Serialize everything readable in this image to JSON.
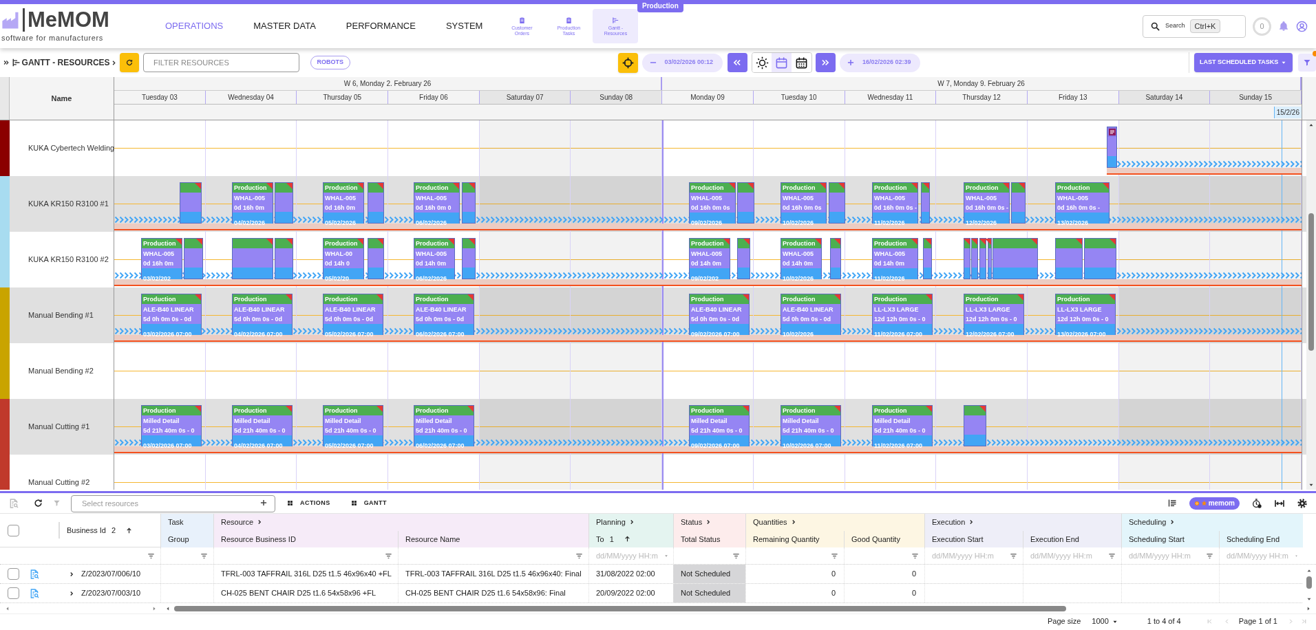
{
  "banner": "Production",
  "header": {
    "brand": "MeMOM",
    "tagline": "software for manufacturers",
    "nav": [
      {
        "label": "OPERATIONS",
        "selected": true
      },
      {
        "label": "MASTER DATA",
        "selected": false
      },
      {
        "label": "PERFORMANCE",
        "selected": false
      },
      {
        "label": "SYSTEM",
        "selected": false
      }
    ],
    "quick_links": [
      {
        "label": "Customer Orders",
        "selected": false
      },
      {
        "label": "Production Tasks",
        "selected": false
      },
      {
        "label": "Gantt - Resources",
        "selected": true
      }
    ],
    "search": {
      "label": "Search",
      "shortcut": "Ctrl+K"
    },
    "notification_count": "0"
  },
  "toolbar": {
    "title": "GANTT - RESOURCES",
    "filter": {
      "placeholder": "FILTER RESOURCES"
    },
    "chip": "ROBOTS",
    "range_start": "03/02/2026 00:12",
    "range_end": "16/02/2026 02:39",
    "view_modes": [
      {
        "kind": "sun",
        "selected": false
      },
      {
        "kind": "calendar",
        "selected": true
      },
      {
        "kind": "calendar-grid",
        "selected": false
      }
    ],
    "scheduled_menu": "LAST SCHEDULED TASKS",
    "filter_active": true
  },
  "gantt": {
    "name_heading": "Name",
    "today_label": "15/2/26",
    "weeks": [
      {
        "label": "W 6, Monday 2. February 26",
        "days": [
          {
            "label": "Tuesday 03",
            "weekend": false
          },
          {
            "label": "Wednesday 04",
            "weekend": false
          },
          {
            "label": "Thursday 05",
            "weekend": false
          },
          {
            "label": "Friday 06",
            "weekend": false
          },
          {
            "label": "Saturday 07",
            "weekend": true
          },
          {
            "label": "Sunday 08",
            "weekend": true
          }
        ]
      },
      {
        "label": "W 7, Monday 9. February 26",
        "days": [
          {
            "label": "Monday 09",
            "weekend": false
          },
          {
            "label": "Tuesday 10",
            "weekend": false
          },
          {
            "label": "Wednesday 11",
            "weekend": false
          },
          {
            "label": "Thursday 12",
            "weekend": false
          },
          {
            "label": "Friday 13",
            "weekend": false
          },
          {
            "label": "Saturday 14",
            "weekend": true
          },
          {
            "label": "Sunday 15",
            "weekend": true
          }
        ]
      }
    ],
    "rows": [
      {
        "name": "KUKA Cybertech Welding",
        "color": "#8b0000",
        "tasks": [
          {
            "kind": "note"
          }
        ]
      },
      {
        "name": "KUKA KR150 R3100 #1",
        "color": "#a8dcf0",
        "tasks": [
          {
            "kind": "block"
          },
          {
            "kind": "card",
            "type": "Production",
            "product": "WHAL-005",
            "duration": "0d 16h 0m",
            "date": "04/02/2026"
          },
          {
            "kind": "block"
          },
          {
            "kind": "card",
            "type": "Production",
            "product": "WHAL-005",
            "duration": "0d 16h 0m",
            "date": "05/02/2026"
          },
          {
            "kind": "block"
          },
          {
            "kind": "card",
            "type": "Production",
            "product": "WHAL-005",
            "duration": "0d 16h 0m 0",
            "date": "06/02/2026"
          },
          {
            "kind": "block"
          },
          {
            "kind": "card",
            "type": "Production",
            "product": "WHAL-005",
            "duration": "0d 16h 0m 0s",
            "date": "09/02/2026"
          },
          {
            "kind": "block"
          },
          {
            "kind": "card",
            "type": "Production",
            "product": "WHAL-005",
            "duration": "0d 16h 0m 0s",
            "date": "10/02/2026"
          },
          {
            "kind": "block"
          },
          {
            "kind": "card",
            "type": "Production",
            "product": "WHAL-005",
            "duration": "0d 16h 0m 0s -",
            "date": "11/02/2026"
          },
          {
            "kind": "block"
          },
          {
            "kind": "card",
            "type": "Production",
            "product": "WHAL-005",
            "duration": "0d 16h 0m 0s -",
            "date": "12/02/2026"
          },
          {
            "kind": "block"
          },
          {
            "kind": "card",
            "type": "Production",
            "product": "WHAL-005",
            "duration": "0d 16h 0m 0s -",
            "date": "13/02/2026"
          }
        ]
      },
      {
        "name": "KUKA KR150 R3100 #2",
        "color": "#a8dcf0",
        "tasks": [
          {
            "kind": "card",
            "type": "Production",
            "product": "WHAL-005",
            "duration": "0d 16h 0m",
            "date": "03/02/202"
          },
          {
            "kind": "block"
          },
          {
            "kind": "block"
          },
          {
            "kind": "block"
          },
          {
            "kind": "card",
            "type": "Production",
            "product": "WHAL-00",
            "duration": "0d 14h 0",
            "date": "05/02/20"
          },
          {
            "kind": "block"
          },
          {
            "kind": "card",
            "type": "Production",
            "product": "WHAL-005",
            "duration": "0d 14h 0m",
            "date": "06/02/2026"
          },
          {
            "kind": "block"
          },
          {
            "kind": "card",
            "type": "Production",
            "product": "WHAL-005",
            "duration": "0d 14h 0m",
            "date": "09/02/202"
          },
          {
            "kind": "block"
          },
          {
            "kind": "card",
            "type": "Production",
            "product": "WHAL-005",
            "duration": "0d 14h 0m",
            "date": "10/02/2026"
          },
          {
            "kind": "block"
          },
          {
            "kind": "card",
            "type": "Production",
            "product": "WHAL-005",
            "duration": "0d 14h 0m",
            "date": "11/02/2026"
          },
          {
            "kind": "block"
          },
          {
            "kind": "block"
          },
          {
            "kind": "block"
          },
          {
            "kind": "block"
          },
          {
            "kind": "block"
          },
          {
            "kind": "block"
          },
          {
            "kind": "block"
          },
          {
            "kind": "block"
          }
        ]
      },
      {
        "name": "Manual Bending #1",
        "color": "#c9a400",
        "tasks": [
          {
            "kind": "card",
            "type": "Production",
            "product": "ALE-B40 LINEAR",
            "duration": "5d 0h 0m 0s - 0d",
            "date": "03/02/2026 07:00"
          },
          {
            "kind": "card",
            "type": "Production",
            "product": "ALE-B40 LINEAR",
            "duration": "5d 0h 0m 0s - 0d",
            "date": "04/02/2026 07:00"
          },
          {
            "kind": "card",
            "type": "Production",
            "product": "ALE-B40 LINEAR",
            "duration": "5d 0h 0m 0s - 0d",
            "date": "05/02/2026 07:00"
          },
          {
            "kind": "card",
            "type": "Production",
            "product": "ALE-B40 LINEAR",
            "duration": "5d 0h 0m 0s - 0d",
            "date": "06/02/2026 07:00"
          },
          {
            "kind": "card",
            "type": "Production",
            "product": "ALE-B40 LINEAR",
            "duration": "5d 0h 0m 0s - 0d",
            "date": "09/02/2026 07:00"
          },
          {
            "kind": "card",
            "type": "Production",
            "product": "ALE-B40 LINEAR",
            "duration": "5d 0h 0m 0s - 0d",
            "date": "10/02/2026"
          },
          {
            "kind": "card",
            "type": "Production",
            "product": "LL-LX3 LARGE",
            "duration": "12d 12h 0m 0s - 0",
            "date": "11/02/2026 07:00"
          },
          {
            "kind": "card",
            "type": "Production",
            "product": "LL-LX3 LARGE",
            "duration": "12d 12h 0m 0s - 0",
            "date": "12/02/2026 07:00"
          },
          {
            "kind": "card",
            "type": "Production",
            "product": "LL-LX3 LARGE",
            "duration": "12d 12h 0m 0s - 0",
            "date": "13/02/2026 07:00"
          }
        ]
      },
      {
        "name": "Manual Bending #2",
        "color": "#c9a400"
      },
      {
        "name": "Manual Cutting #1",
        "color": "#c0392b",
        "tasks": [
          {
            "kind": "card",
            "type": "Production",
            "product": "Milled Detail",
            "duration": "5d 21h 40m 0s - 0",
            "date": "03/02/2026 07:00"
          },
          {
            "kind": "card",
            "type": "Production",
            "product": "Milled Detail",
            "duration": "5d 21h 40m 0s - 0",
            "date": "04/02/2026 07:00"
          },
          {
            "kind": "card",
            "type": "Production",
            "product": "Milled Detail",
            "duration": "5d 21h 40m 0s - 0",
            "date": "05/02/2026 07:00"
          },
          {
            "kind": "card",
            "type": "Production",
            "product": "Milled Detail",
            "duration": "5d 21h 40m 0s - 0",
            "date": "06/02/2026 07:00"
          },
          {
            "kind": "card",
            "type": "Production",
            "product": "Milled Detail",
            "duration": "5d 21h 40m 0s - 0",
            "date": "09/02/2026 07:00"
          },
          {
            "kind": "card",
            "type": "Production",
            "product": "Milled Detail",
            "duration": "5d 21h 40m 0s - 0",
            "date": "10/02/2026 07:00"
          },
          {
            "kind": "card",
            "type": "Production",
            "product": "Milled Detail",
            "duration": "5d 21h 40m 0s - 0",
            "date": "11/02/2026 07:00"
          },
          {
            "kind": "block"
          }
        ]
      },
      {
        "name": "Manual Cutting #2",
        "color": "#c0392b"
      }
    ]
  },
  "grid": {
    "search": {
      "placeholder": "Select resources"
    },
    "actions": [
      "ACTIONS",
      "GANTT"
    ],
    "badge": "memom",
    "header_checkbox": {
      "checked": false
    },
    "id_column": {
      "label": "Business Id",
      "sort_index": "2",
      "sort_ascending": true
    },
    "groups": [
      {
        "label": "Task",
        "expandable": false,
        "color": "#e8f1fb",
        "columns": [
          {
            "label": "Group"
          }
        ]
      },
      {
        "label": "Resource",
        "expandable": true,
        "color": "#f6ebf8",
        "columns": [
          {
            "label": "Resource Business ID"
          },
          {
            "label": "Resource Name"
          }
        ]
      },
      {
        "label": "Planning",
        "expandable": true,
        "color": "#e4f4f0",
        "columns": [
          {
            "label": "To",
            "sort_index": "1",
            "sort_ascending": true,
            "filter_placeholder": "dd/MM/yyyy HH:m"
          }
        ]
      },
      {
        "label": "Status",
        "expandable": true,
        "color": "#fdecec",
        "columns": [
          {
            "label": "Total Status"
          }
        ]
      },
      {
        "label": "Quantities",
        "expandable": true,
        "color": "#fdf6e3",
        "columns": [
          {
            "label": "Remaining Quantity"
          },
          {
            "label": "Good Quantity"
          }
        ]
      },
      {
        "label": "Execution",
        "expandable": true,
        "color": "#eeeef8",
        "columns": [
          {
            "label": "Execution Start",
            "filter_placeholder": "dd/MM/yyyy HH:m"
          },
          {
            "label": "Execution End",
            "filter_placeholder": "dd/MM/yyyy HH:m"
          }
        ]
      },
      {
        "label": "Scheduling",
        "expandable": true,
        "color": "#e3f5fb",
        "columns": [
          {
            "label": "Scheduling Start",
            "filter_placeholder": "dd/MM/yyyy HH:m"
          },
          {
            "label": "Scheduling End",
            "filter_placeholder": "dd/MM/yyyy HH:m"
          }
        ]
      }
    ],
    "rows": [
      {
        "checked": false,
        "expanded": false,
        "business_id": "Z/2023/07/006/10",
        "resource_business_id": "TFRL-003 TAFFRAIL 316L D25 t1.5 46x96x40 +FL",
        "resource_name": "TFRL-003 TAFFRAIL 316L D25 t1.5 46x96x40: Final",
        "planning_to": "31/08/2022 02:00",
        "total_status": "Not Scheduled",
        "remaining_quantity": "0",
        "good_quantity": "0"
      },
      {
        "checked": false,
        "expanded": false,
        "business_id": "Z/2023/07/003/10",
        "resource_business_id": "CH-025 BENT CHAIR D25 t1.6 54x58x96 +FL",
        "resource_name": "CH-025 BENT CHAIR D25 t1.6 54x58x96: Final",
        "planning_to": "20/09/2022 02:00",
        "total_status": "Not Scheduled",
        "remaining_quantity": "0",
        "good_quantity": "0"
      }
    ],
    "pagination": {
      "page_size_label": "Page size",
      "page_size": "1000",
      "range": "1 to 4 of 4",
      "page": "Page 1 of 1"
    }
  }
}
